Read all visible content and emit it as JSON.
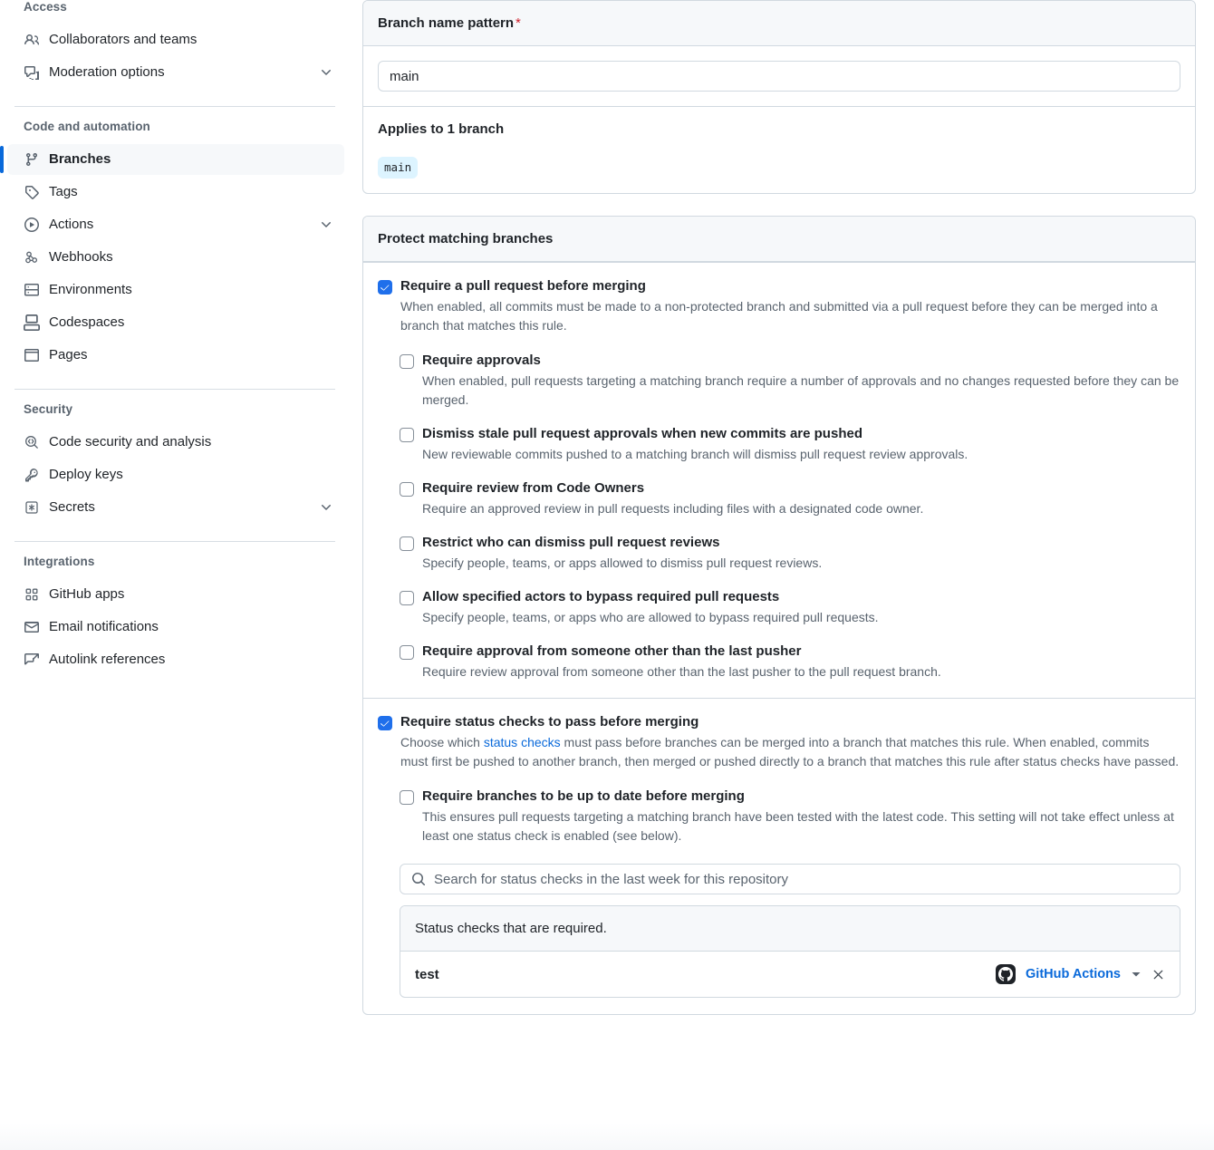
{
  "colors": {
    "accent": "#0969da",
    "checkbox_checked": "#1f6feb",
    "required_star": "#cf222e",
    "header_bg": "#f6f8fa",
    "border": "#d1d9e0",
    "muted_text": "#59636e",
    "chip_bg": "#ddf4ff"
  },
  "sidebar": {
    "groups": [
      {
        "title": "Access",
        "items": [
          {
            "label": "Collaborators and teams",
            "icon": "people-icon",
            "active": false,
            "expandable": false
          },
          {
            "label": "Moderation options",
            "icon": "comment-discussion-icon",
            "active": false,
            "expandable": true
          }
        ]
      },
      {
        "title": "Code and automation",
        "items": [
          {
            "label": "Branches",
            "icon": "git-branch-icon",
            "active": true,
            "expandable": false
          },
          {
            "label": "Tags",
            "icon": "tag-icon",
            "active": false,
            "expandable": false
          },
          {
            "label": "Actions",
            "icon": "play-circle-icon",
            "active": false,
            "expandable": true
          },
          {
            "label": "Webhooks",
            "icon": "webhook-icon",
            "active": false,
            "expandable": false
          },
          {
            "label": "Environments",
            "icon": "server-icon",
            "active": false,
            "expandable": false
          },
          {
            "label": "Codespaces",
            "icon": "codespaces-icon",
            "active": false,
            "expandable": false
          },
          {
            "label": "Pages",
            "icon": "browser-icon",
            "active": false,
            "expandable": false
          }
        ]
      },
      {
        "title": "Security",
        "items": [
          {
            "label": "Code security and analysis",
            "icon": "codescan-icon",
            "active": false,
            "expandable": false
          },
          {
            "label": "Deploy keys",
            "icon": "key-icon",
            "active": false,
            "expandable": false
          },
          {
            "label": "Secrets",
            "icon": "asterisk-box-icon",
            "active": false,
            "expandable": true
          }
        ]
      },
      {
        "title": "Integrations",
        "items": [
          {
            "label": "GitHub apps",
            "icon": "apps-grid-icon",
            "active": false,
            "expandable": false
          },
          {
            "label": "Email notifications",
            "icon": "mail-icon",
            "active": false,
            "expandable": false
          },
          {
            "label": "Autolink references",
            "icon": "cross-reference-icon",
            "active": false,
            "expandable": false
          }
        ]
      }
    ]
  },
  "branch_pattern_card": {
    "header": "Branch name pattern",
    "required_marker": "*",
    "input_value": "main",
    "applies_title": "Applies to 1 branch",
    "branches": [
      "main"
    ]
  },
  "protect_card": {
    "header": "Protect matching branches",
    "pull_request": {
      "checked": true,
      "label": "Require a pull request before merging",
      "description": "When enabled, all commits must be made to a non-protected branch and submitted via a pull request before they can be merged into a branch that matches this rule.",
      "sub_options": [
        {
          "checked": false,
          "label": "Require approvals",
          "description": "When enabled, pull requests targeting a matching branch require a number of approvals and no changes requested before they can be merged."
        },
        {
          "checked": false,
          "label": "Dismiss stale pull request approvals when new commits are pushed",
          "description": "New reviewable commits pushed to a matching branch will dismiss pull request review approvals."
        },
        {
          "checked": false,
          "label": "Require review from Code Owners",
          "description": "Require an approved review in pull requests including files with a designated code owner."
        },
        {
          "checked": false,
          "label": "Restrict who can dismiss pull request reviews",
          "description": "Specify people, teams, or apps allowed to dismiss pull request reviews."
        },
        {
          "checked": false,
          "label": "Allow specified actors to bypass required pull requests",
          "description": "Specify people, teams, or apps who are allowed to bypass required pull requests."
        },
        {
          "checked": false,
          "label": "Require approval from someone other than the last pusher",
          "description": "Require review approval from someone other than the last pusher to the pull request branch."
        }
      ]
    },
    "status_checks": {
      "checked": true,
      "label": "Require status checks to pass before merging",
      "description_part1": "Choose which ",
      "description_link": "status checks",
      "description_part2": " must pass before branches can be merged into a branch that matches this rule. When enabled, commits must first be pushed to another branch, then merged or pushed directly to a branch that matches this rule after status checks have passed.",
      "sub_options": [
        {
          "checked": false,
          "label": "Require branches to be up to date before merging",
          "description": "This ensures pull requests targeting a matching branch have been tested with the latest code. This setting will not take effect unless at least one status check is enabled (see below)."
        }
      ],
      "search_placeholder": "Search for status checks in the last week for this repository",
      "panel_header": "Status checks that are required.",
      "rows": [
        {
          "name": "test",
          "app": "GitHub Actions"
        }
      ]
    }
  }
}
